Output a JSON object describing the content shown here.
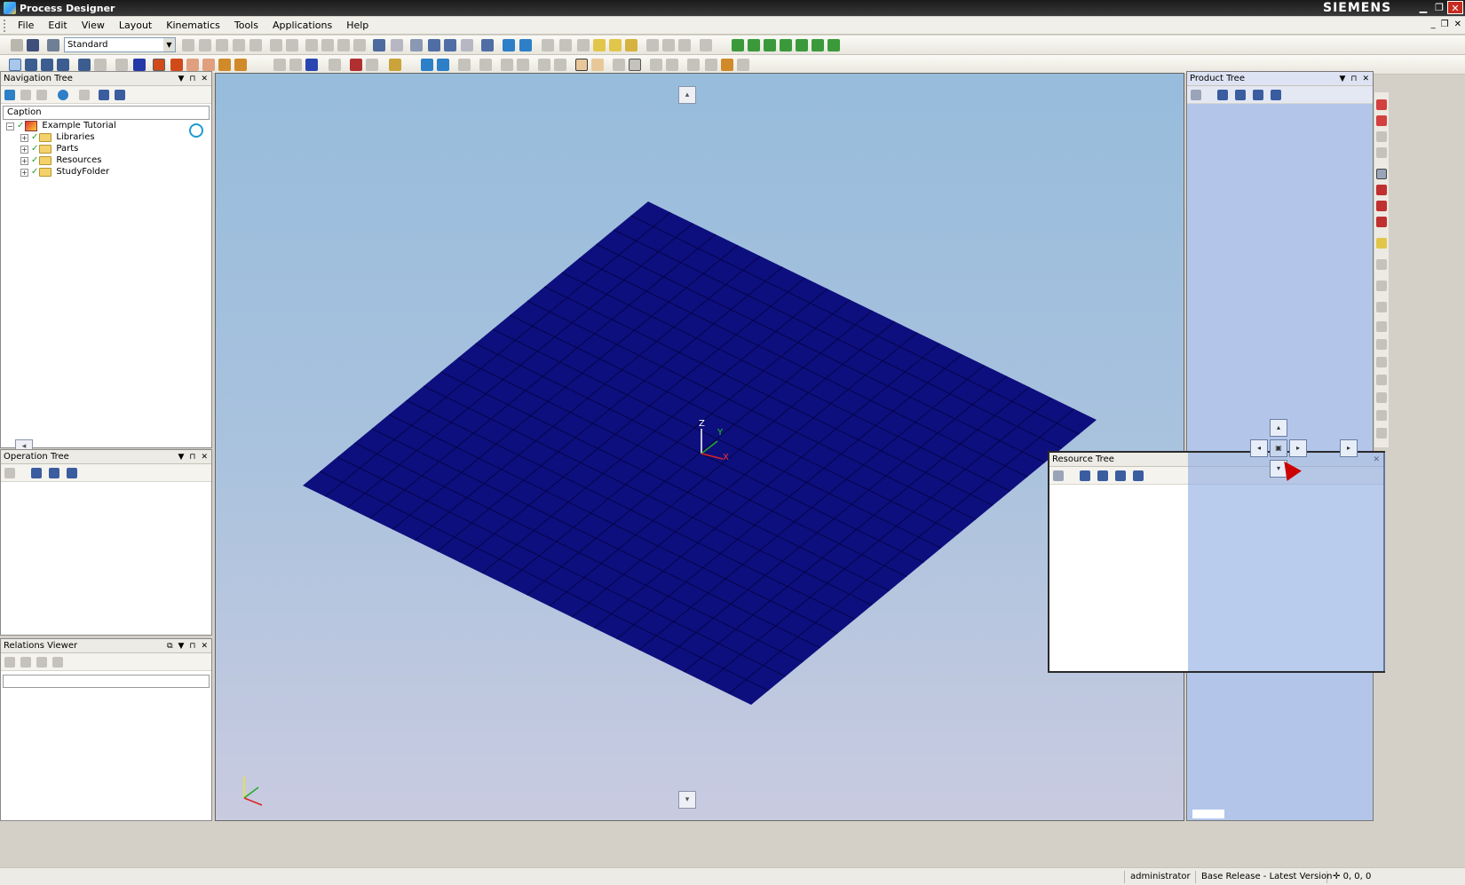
{
  "window": {
    "title": "Process Designer",
    "brand": "SIEMENS",
    "minimize": "▁",
    "maximize": "❐",
    "close": "✕"
  },
  "menu": {
    "items": [
      "File",
      "Edit",
      "View",
      "Layout",
      "Kinematics",
      "Tools",
      "Applications",
      "Help"
    ],
    "mdi_min": "_",
    "mdi_restore": "❐",
    "mdi_close": "✕"
  },
  "toolbar": {
    "layout_combo_value": "Standard"
  },
  "navigation_tree": {
    "title": "Navigation Tree",
    "column_header": "Caption",
    "root": "Example Tutorial",
    "children": [
      "Libraries",
      "Parts",
      "Resources",
      "StudyFolder"
    ]
  },
  "operation_tree": {
    "title": "Operation Tree"
  },
  "relations_viewer": {
    "title": "Relations Viewer"
  },
  "product_tree": {
    "title": "Product Tree"
  },
  "resource_tree": {
    "title": "Resource Tree"
  },
  "viewport": {
    "axis_z": "Z",
    "axis_y": "Y",
    "axis_x": "X",
    "plate_color": "#0e0f7e",
    "grid_color": "#05054a"
  },
  "panel_controls": {
    "dropdown": "▼",
    "pin": "⊓",
    "close": "✕"
  },
  "statusbar": {
    "user": "administrator",
    "version": "Base Release - Latest Version",
    "coords": "0, 0, 0"
  },
  "colors": {
    "accent_red": "#c62b20",
    "viewport_top": "#97bcdc",
    "viewport_bottom": "#c9cbe0",
    "dock_highlight": "#b3c6ea"
  }
}
